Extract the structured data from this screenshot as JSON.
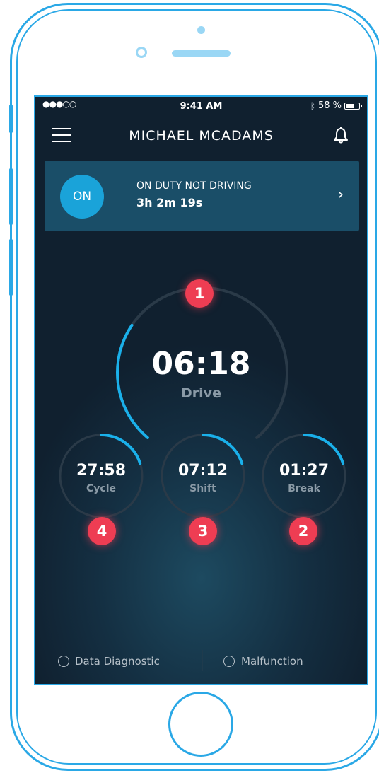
{
  "status_bar": {
    "signal": "●●●○○",
    "time": "9:41 AM",
    "bluetooth_icon": "bluetooth-icon",
    "battery": "58 %"
  },
  "header": {
    "title": "MICHAEL MCADAMS",
    "menu_icon": "hamburger-menu-icon",
    "notification_icon": "bell-icon"
  },
  "duty": {
    "badge": "ON",
    "status": "ON DUTY NOT DRIVING",
    "elapsed": "3h 2m 19s"
  },
  "main_gauge": {
    "value": "06:18",
    "label": "Drive",
    "badge": "1",
    "progress": 0.3
  },
  "small_gauges": [
    {
      "value": "27:58",
      "label": "Cycle",
      "badge": "4",
      "progress": 0.2
    },
    {
      "value": "07:12",
      "label": "Shift",
      "badge": "3",
      "progress": 0.2
    },
    {
      "value": "01:27",
      "label": "Break",
      "badge": "2",
      "progress": 0.2
    }
  ],
  "footer": {
    "left_label": "Data Diagnostic",
    "right_label": "Malfunction"
  },
  "colors": {
    "accent": "#1ab0ea",
    "badge": "#ee3d53",
    "track": "#2a3a48"
  }
}
